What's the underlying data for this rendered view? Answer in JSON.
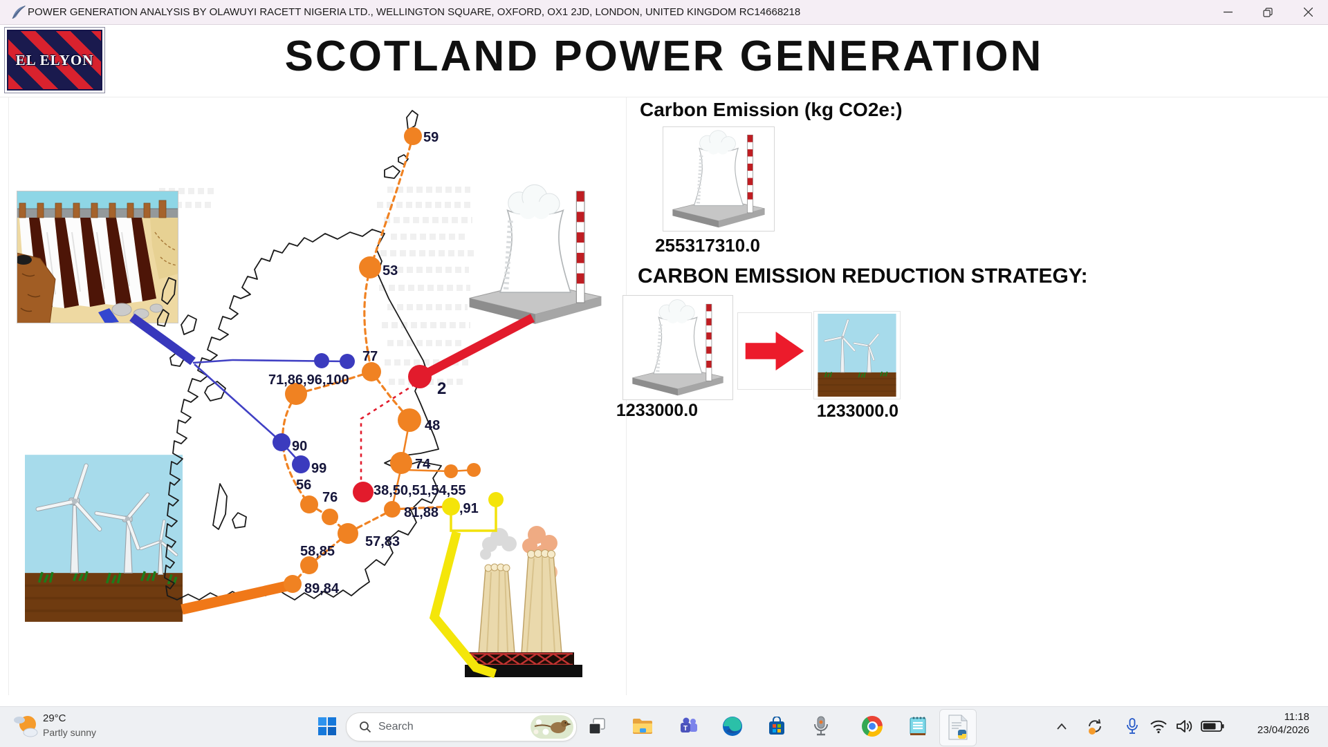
{
  "titlebar": {
    "title": "POWER GENERATION ANALYSIS BY OLAWUYI RACETT NIGERIA LTD., WELLINGTON SQUARE, OXFORD, OX1 2JD, LONDON, UNITED KINGDOM RC14668218"
  },
  "header": {
    "logo": "EL ELYON",
    "title": "SCOTLAND POWER GENERATION"
  },
  "panel": {
    "emission_heading": "Carbon Emission (kg CO2e:)",
    "emission_value": "255317310.0",
    "strategy_heading": "CARBON EMISSION REDUCTION STRATEGY:",
    "before_value": "1233000.0",
    "after_value": "1233000.0"
  },
  "map": {
    "labels": [
      "59",
      "53",
      "77",
      "71,86,96,100",
      "2",
      "48",
      "90",
      "99",
      "74",
      "56",
      "76",
      "38,50,51,54,55",
      "81,88",
      ",91",
      "57,83",
      "58,85",
      "89,84"
    ]
  },
  "taskbar": {
    "weather_temp": "29°C",
    "weather_desc": "Partly sunny",
    "search_label": "Search",
    "time": "11:18",
    "date": "23/04/2026"
  }
}
